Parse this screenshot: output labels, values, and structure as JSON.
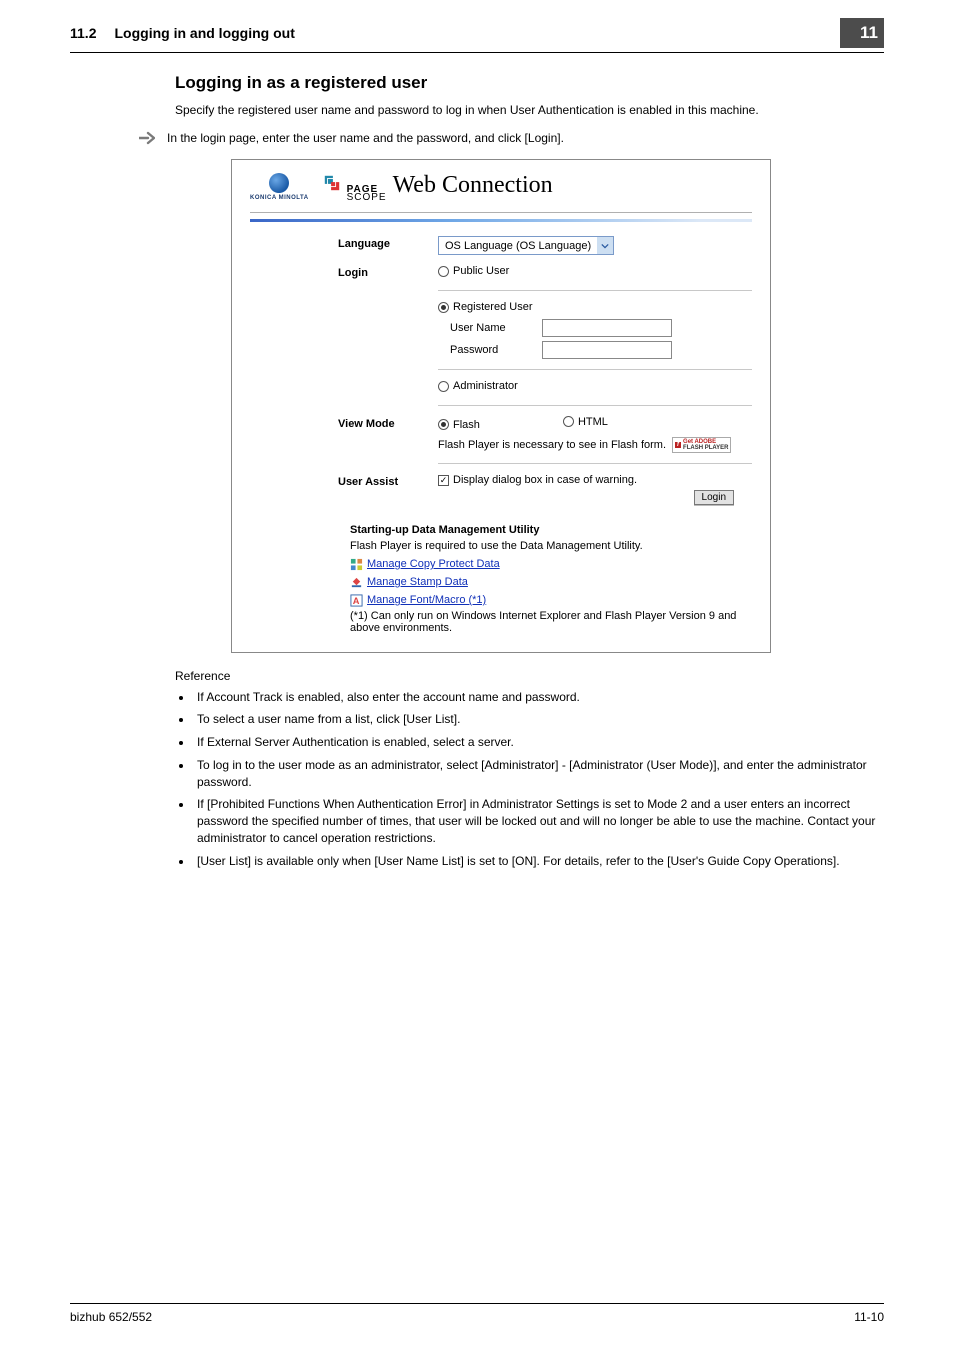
{
  "header": {
    "section_number": "11.2",
    "section_title": "Logging in and logging out",
    "chapter": "11"
  },
  "heading": "Logging in as a registered user",
  "intro": "Specify the registered user name and password to log in when User Authentication is enabled in this machine.",
  "step": "In the login page, enter the user name and the password, and click [Login].",
  "figure": {
    "brand": "KONICA MINOLTA",
    "pagescope_top": "PAGE",
    "pagescope_bottom": "SCOPE",
    "web_connection": "Web Connection",
    "rows": {
      "language": {
        "label": "Language",
        "value": "OS Language (OS Language)"
      },
      "login": {
        "label": "Login",
        "public": "Public User",
        "registered": "Registered User",
        "user_name": "User Name",
        "password": "Password",
        "admin": "Administrator"
      },
      "view_mode": {
        "label": "View Mode",
        "flash": "Flash",
        "html": "HTML",
        "flash_note": "Flash Player is necessary to see in Flash form.",
        "badge1": "Get ADOBE",
        "badge2": "FLASH PLAYER"
      },
      "user_assist": {
        "label": "User Assist",
        "checkbox": "Display dialog box in case of warning."
      },
      "login_btn": "Login"
    },
    "utility": {
      "title": "Starting-up Data Management Utility",
      "line": "Flash Player is required to use the Data Management Utility.",
      "link1": "Manage Copy Protect Data",
      "link2": "Manage Stamp Data",
      "link3": "Manage Font/Macro (*1)",
      "note": "(*1) Can only run on Windows Internet Explorer and Flash Player Version 9 and above environments."
    }
  },
  "reference_label": "Reference",
  "reference": [
    "If Account Track is enabled, also enter the account name and password.",
    "To select a user name from a list, click [User List].",
    "If External Server Authentication is enabled, select a server.",
    "To log in to the user mode as an administrator, select [Administrator] - [Administrator (User Mode)], and enter the administrator password.",
    "If [Prohibited Functions When Authentication Error] in Administrator Settings is set to Mode 2 and a user enters an incorrect password the specified number of times, that user will be locked out and will no longer be able to use the machine. Contact your administrator to cancel operation restrictions.",
    "[User List] is available only when [User Name List] is set to [ON]. For details, refer to the [User's Guide Copy Operations]."
  ],
  "footer": {
    "left": "bizhub 652/552",
    "right": "11-10"
  }
}
